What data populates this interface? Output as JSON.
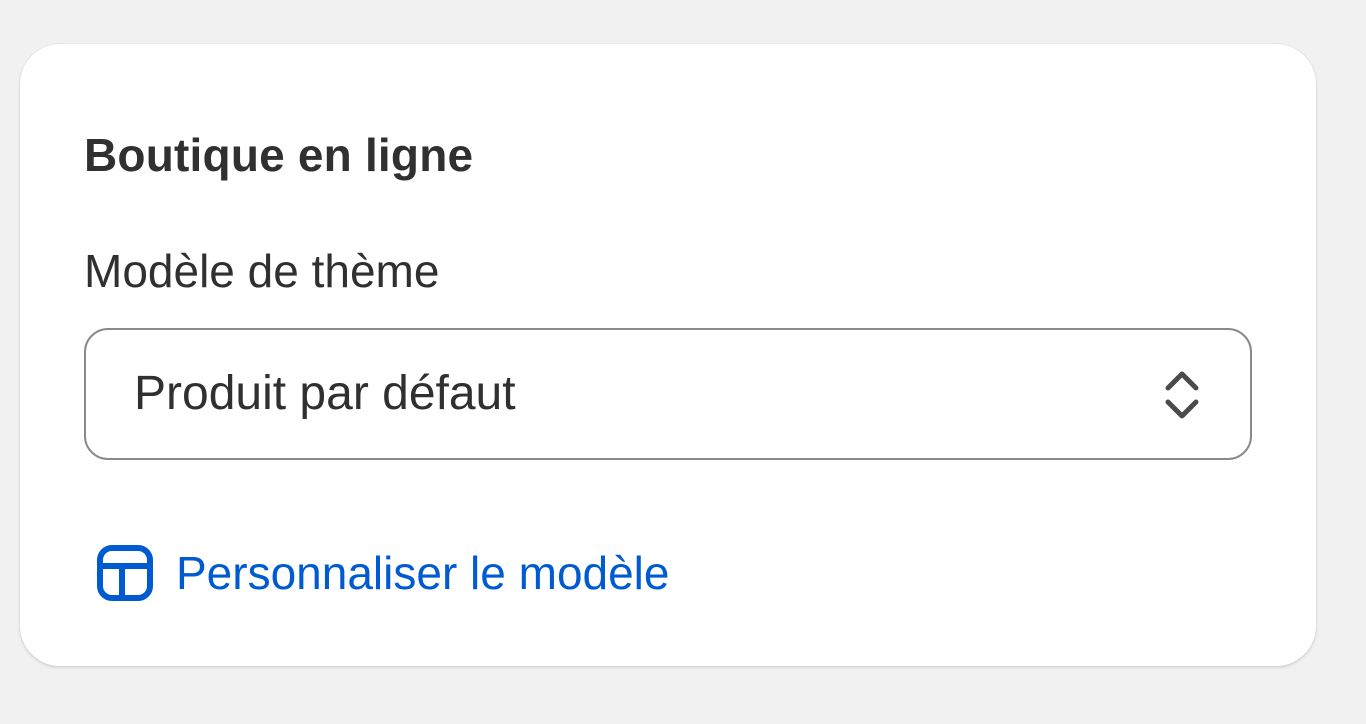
{
  "card": {
    "title": "Boutique en ligne",
    "theme_template": {
      "label": "Modèle de thème",
      "selected_value": "Produit par défaut"
    },
    "customize_link": {
      "label": "Personnaliser le modèle",
      "icon": "layout-template-icon"
    }
  },
  "colors": {
    "background": "#f1f1f1",
    "card": "#ffffff",
    "text": "#303030",
    "link": "#005bd3",
    "border": "#8a8a8a"
  }
}
